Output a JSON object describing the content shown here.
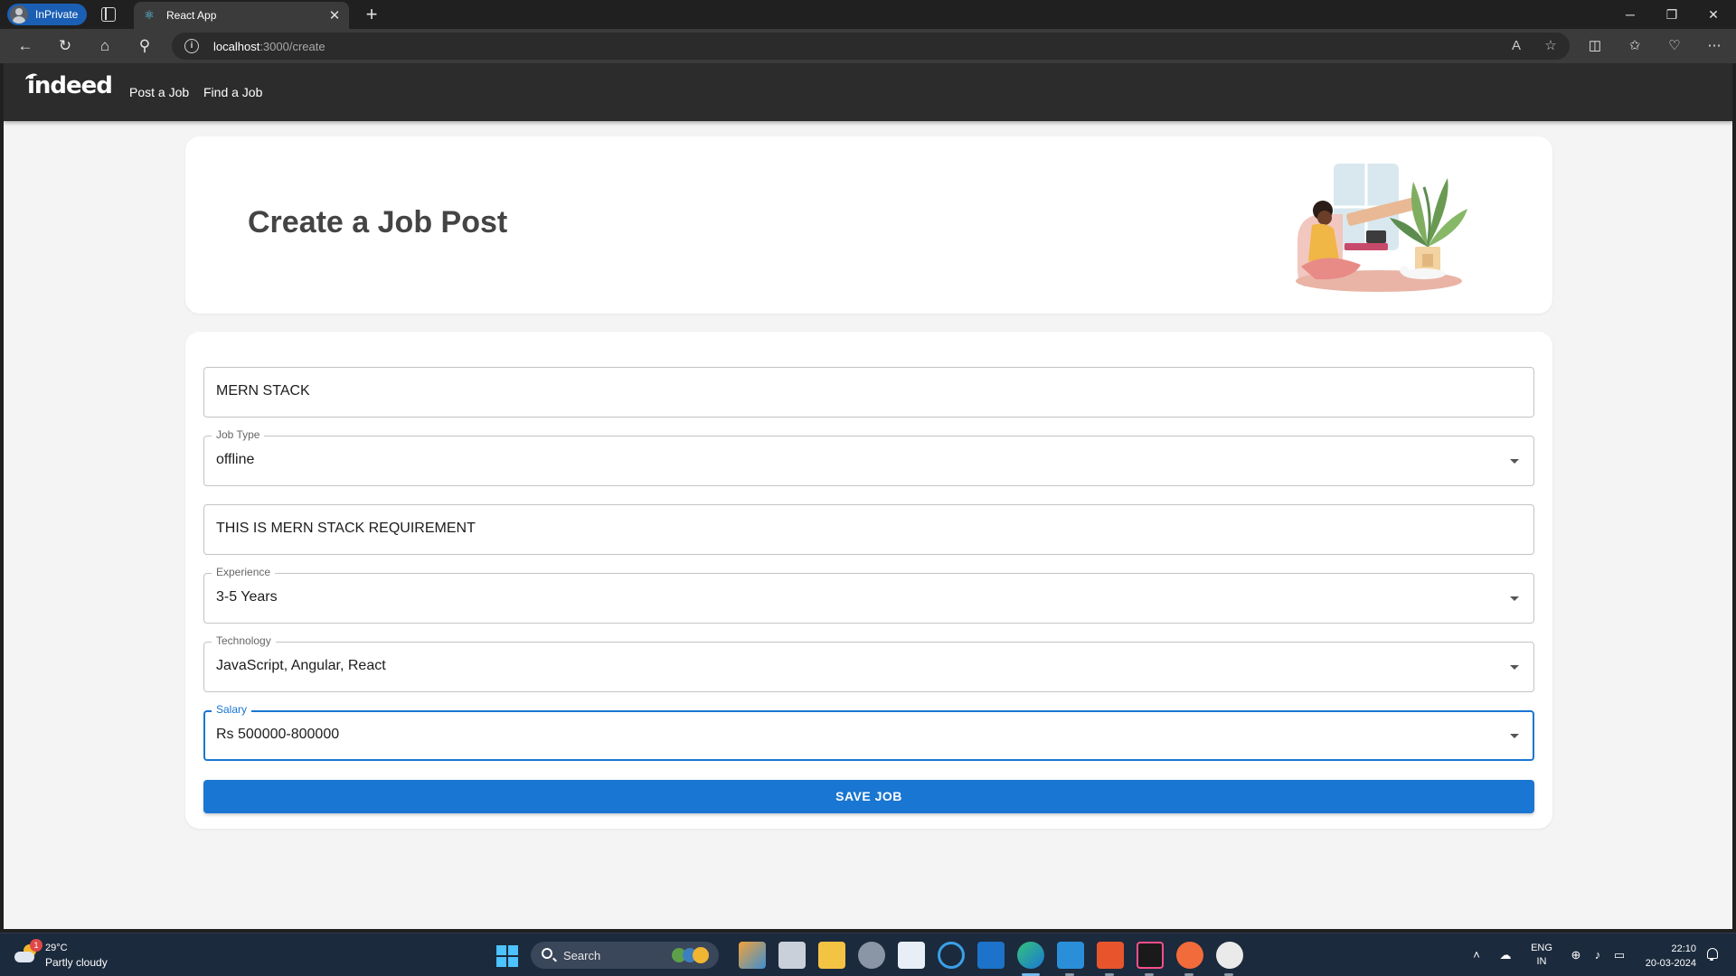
{
  "browser": {
    "inprivate_label": "InPrivate",
    "tab_title": "React App",
    "url_host": "localhost",
    "url_path": ":3000/create"
  },
  "nav": {
    "logo": "indeed",
    "links": [
      "Post a Job",
      "Find a Job"
    ]
  },
  "hero": {
    "title": "Create a Job Post"
  },
  "form": {
    "title_value": "MERN STACK",
    "job_type": {
      "label": "Job Type",
      "value": "offline"
    },
    "description_value": "THIS IS MERN STACK REQUIREMENT",
    "experience": {
      "label": "Experience",
      "value": "3-5 Years"
    },
    "technology": {
      "label": "Technology",
      "value": "JavaScript, Angular, React"
    },
    "salary": {
      "label": "Salary",
      "value": "Rs 500000-800000"
    },
    "save_label": "SAVE JOB"
  },
  "colors": {
    "primary": "#1976d2",
    "appbar": "#2c2c2c",
    "page_bg": "#f4f4f4"
  },
  "taskbar": {
    "weather_temp": "29°C",
    "weather_condition": "Partly cloudy",
    "weather_badge": "1",
    "search_placeholder": "Search",
    "lang_line1": "ENG",
    "lang_line2": "IN",
    "time": "22:10",
    "date": "20-03-2024"
  }
}
